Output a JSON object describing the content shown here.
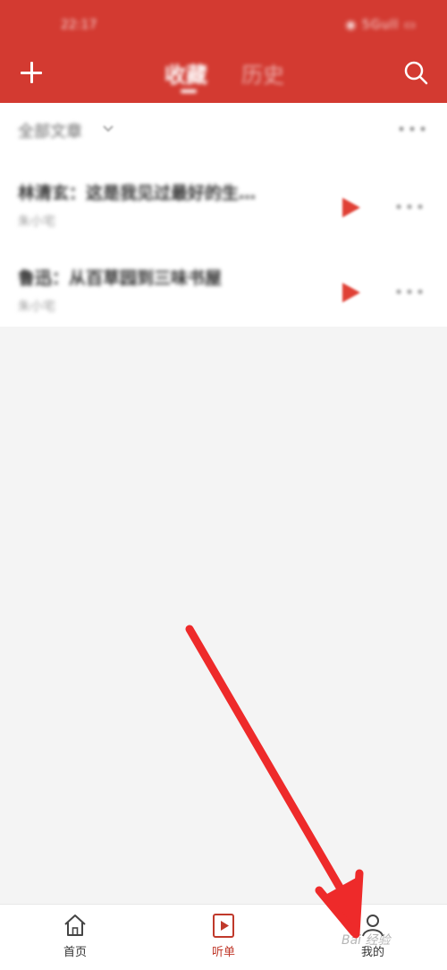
{
  "statusbar": {
    "time": "22:17",
    "icons": "◉ 5Gull ▭"
  },
  "header": {
    "add_icon": "plus-icon",
    "tabs": [
      {
        "label": "收藏",
        "active": true
      },
      {
        "label": "历史",
        "active": false
      }
    ],
    "search_icon": "search-icon",
    "background_color": "#d33a31"
  },
  "filter": {
    "label": "全部文章",
    "chevron_icon": "chevron-down-icon",
    "more_icon": "more-icon"
  },
  "items": [
    {
      "title": "林清玄：这是我见过最好的生…",
      "subtitle": "朱小宅"
    },
    {
      "title": "鲁迅：从百草园到三味书屋",
      "subtitle": "朱小宅"
    }
  ],
  "bottom_nav": [
    {
      "label": "首页",
      "icon": "home-icon",
      "active": false
    },
    {
      "label": "听单",
      "icon": "playlist-icon",
      "active": true
    },
    {
      "label": "我的",
      "icon": "profile-icon",
      "active": false
    }
  ],
  "watermark": "Bai 经验",
  "accent_color": "#d33a31",
  "annotation_color": "#ee2a2a"
}
